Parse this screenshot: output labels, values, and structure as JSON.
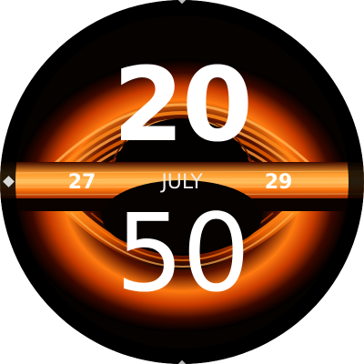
{
  "watch": {
    "hour": "20",
    "minute": "50",
    "month": "JULY",
    "date_prev": "27",
    "date_next": "29",
    "background": "black-hole-accretion-disk",
    "colors": {
      "text": "#ffffff",
      "disk_bright": "#ff8a1a",
      "disk_dark": "#7a1800",
      "void": "#050200"
    }
  }
}
